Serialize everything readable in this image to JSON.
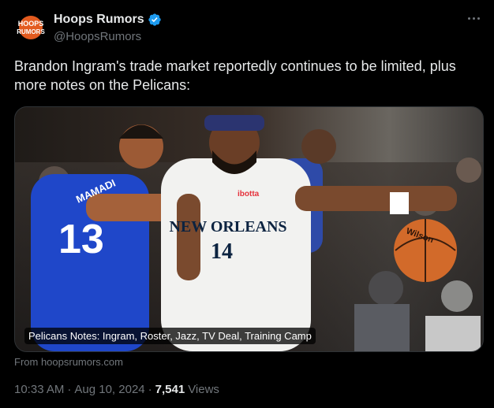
{
  "author": {
    "display_name": "Hoops Rumors",
    "handle": "@HoopsRumors",
    "avatar_text_top": "HOOPS",
    "avatar_text_bottom": "RUMORS"
  },
  "tweet": {
    "text": "Brandon Ingram's trade market reportedly continues to be limited, plus more notes on the Pelicans:"
  },
  "card": {
    "caption": "Pelicans Notes: Ingram, Roster, Jazz, TV Deal, Training Camp",
    "source": "From hoopsrumors.com",
    "jersey_home_team": "NEW ORLEANS",
    "jersey_home_number": "14",
    "jersey_away_number": "13",
    "jersey_away_name": "MAMADI",
    "sponsor": "ibotta",
    "ball_brand": "Wilson"
  },
  "meta": {
    "time": "10:33 AM",
    "separator": "·",
    "date": "Aug 10, 2024",
    "views_count": "7,541",
    "views_label": "Views"
  },
  "colors": {
    "background": "#000000",
    "verified": "#1d9bf0",
    "secondary_text": "#71767b",
    "primary_text": "#e7e9ea"
  }
}
